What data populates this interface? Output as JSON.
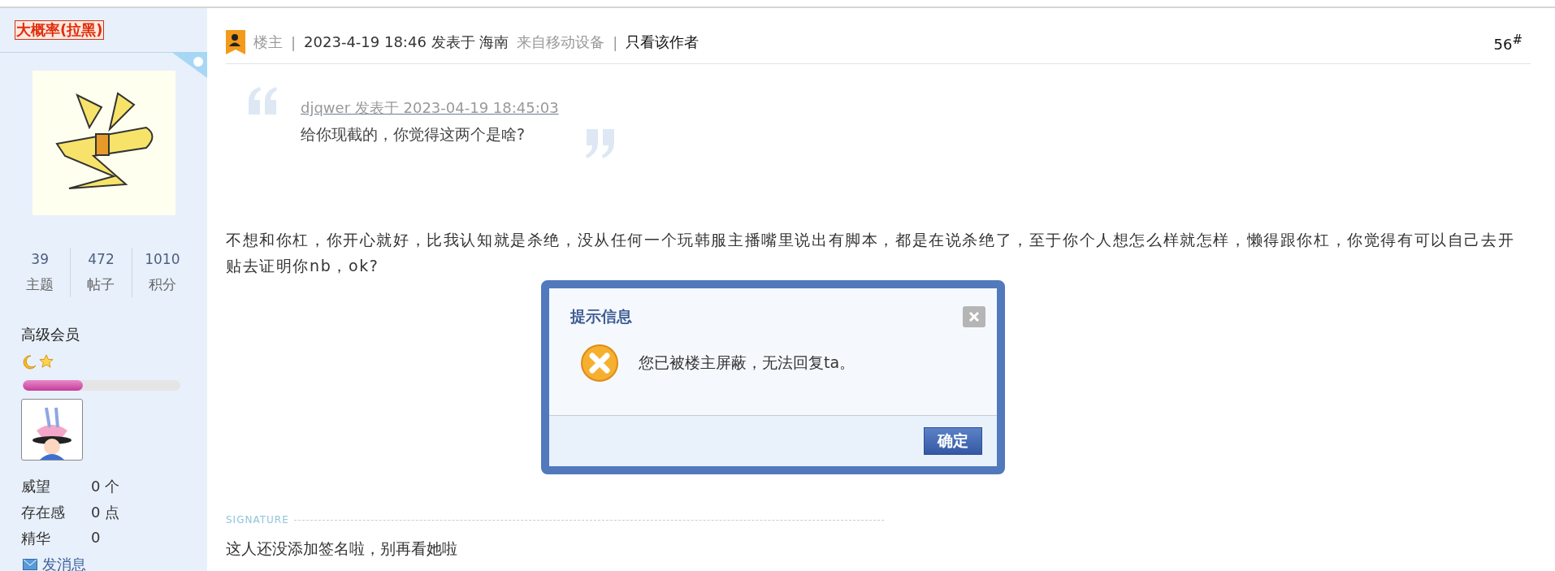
{
  "user": {
    "name": "大概率(拉黑)",
    "device_badge": true,
    "stats": [
      {
        "value": "39",
        "label": "主题"
      },
      {
        "value": "472",
        "label": "帖子"
      },
      {
        "value": "1010",
        "label": "积分"
      }
    ],
    "group": "高级会员",
    "level": 0.38,
    "profile": [
      {
        "label": "威望",
        "value": "0 个"
      },
      {
        "label": "存在感",
        "value": "0 点"
      },
      {
        "label": "精华",
        "value": "0"
      }
    ],
    "send_message": "发消息"
  },
  "post": {
    "role": "楼主",
    "separator_1": "|",
    "datetime": "2023-4-19 18:46 发表于 海南",
    "device": "来自移动设备",
    "separator_2": "|",
    "author_only": "只看该作者",
    "floor": "56$^{#}$",
    "quote": {
      "author": "djqwer 发表于 2023-04-19 18:45:03",
      "text": "给你现截的，你觉得这两个是啥?"
    },
    "body": "不想和你杠，你开心就好，比我认知就是杀绝，没从任何一个玩韩服主播嘴里说出有脚本，都是在说杀绝了，至于你个人想怎么样就怎样，懒得跟你杠，你觉得有可以自己去开贴去证明你nb，ok?",
    "signature_label": "SIGNATURE",
    "signature": "这人还没添加签名啦，别再看她啦"
  },
  "dialog": {
    "title": "提示信息",
    "message": "您已被楼主屏蔽，无法回复ta。",
    "confirm": "确定"
  }
}
